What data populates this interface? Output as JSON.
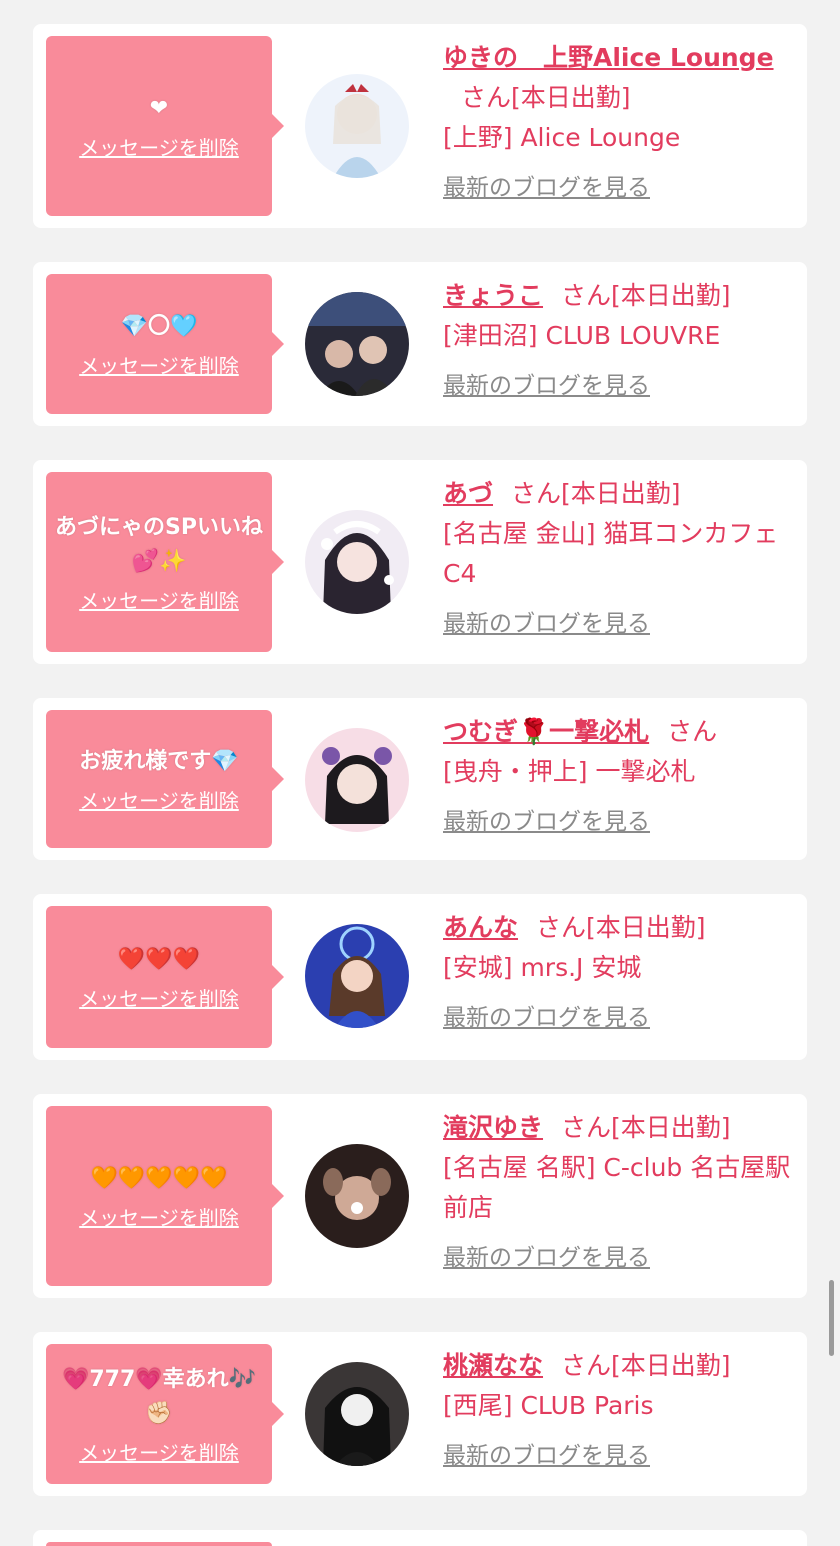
{
  "entries": [
    {
      "message": "❤",
      "delete_label": "メッセージを削除",
      "name": "ゆきの　上野Alice Lounge",
      "suffix": "さん",
      "status": "[本日出勤]",
      "shop": "[上野] Alice Lounge",
      "blog_label": "最新のブログを見る"
    },
    {
      "message": "💎〇🩵",
      "delete_label": "メッセージを削除",
      "name": "きょうこ",
      "suffix": "さん",
      "status": "[本日出勤]",
      "shop": "[津田沼] CLUB LOUVRE",
      "blog_label": "最新のブログを見る"
    },
    {
      "message": "あづにゃのSPいいね💕✨",
      "delete_label": "メッセージを削除",
      "name": "あづ",
      "suffix": "さん",
      "status": "[本日出勤]",
      "shop": "[名古屋 金山] 猫耳コンカフェ C4",
      "blog_label": "最新のブログを見る"
    },
    {
      "message": "お疲れ様です💎",
      "delete_label": "メッセージを削除",
      "name": "つむぎ🌹一撃必札",
      "suffix": "さん",
      "status": "",
      "shop": "[曳舟・押上] 一撃必札",
      "blog_label": "最新のブログを見る"
    },
    {
      "message": "❤️❤️❤️",
      "delete_label": "メッセージを削除",
      "name": "あんな",
      "suffix": "さん",
      "status": "[本日出勤]",
      "shop": "[安城] mrs.J 安城",
      "blog_label": "最新のブログを見る"
    },
    {
      "message": "🧡🧡🧡🧡🧡",
      "delete_label": "メッセージを削除",
      "name": "滝沢ゆき",
      "suffix": "さん",
      "status": "[本日出勤]",
      "shop": "[名古屋 名駅] C-club 名古屋駅前店",
      "blog_label": "最新のブログを見る"
    },
    {
      "message": "💗777💗幸あれ🎶✊🏻",
      "delete_label": "メッセージを削除",
      "name": "桃瀬なな",
      "suffix": "さん",
      "status": "[本日出勤]",
      "shop": "[西尾] CLUB Paris",
      "blog_label": "最新のブログを見る"
    }
  ],
  "colors": {
    "accent": "#e23c5e",
    "bubble": "#f98b9a",
    "page_bg": "#f2f2f2",
    "card_bg": "#ffffff",
    "link_gray": "#8a8a8a"
  }
}
